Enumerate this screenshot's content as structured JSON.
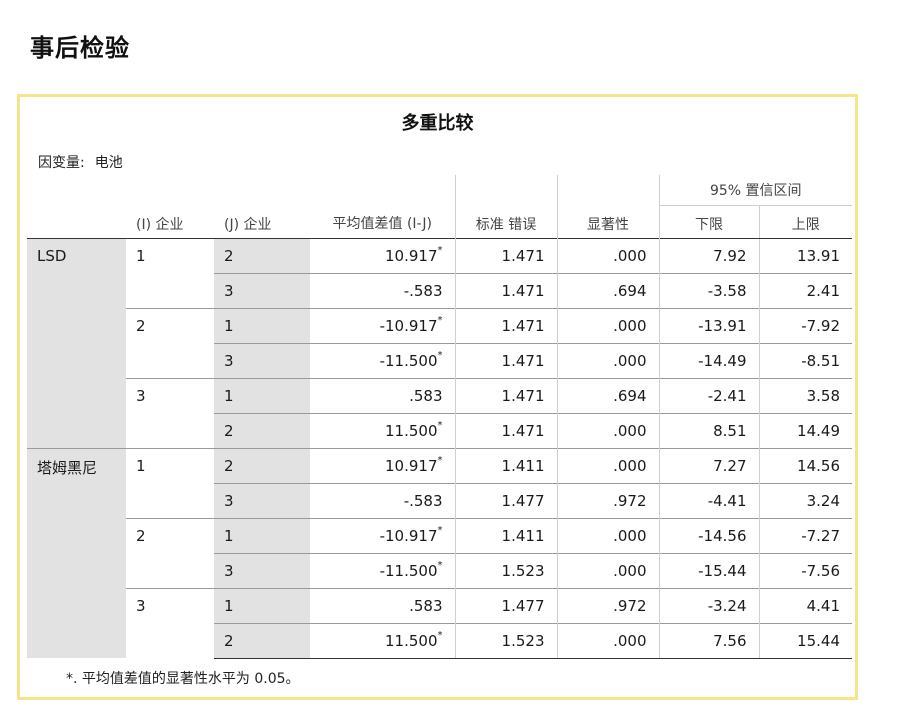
{
  "heading": "事后检验",
  "table": {
    "title": "多重比较",
    "dep_var_label": "因变量:",
    "dep_var_value": "电池",
    "headers": {
      "i": "(I) 企业",
      "j": "(J) 企业",
      "mean_diff": "平均值差值 (I-J)",
      "std_err": "标准 错误",
      "sig": "显著性",
      "ci_group": "95% 置信区间",
      "lower": "下限",
      "upper": "上限"
    },
    "groups": [
      {
        "method": "LSD",
        "blocks": [
          {
            "i": "1",
            "rows": [
              {
                "j": "2",
                "diff": "10.917",
                "star": "*",
                "se": "1.471",
                "sig": ".000",
                "lower": "7.92",
                "upper": "13.91"
              },
              {
                "j": "3",
                "diff": "-.583",
                "star": "",
                "se": "1.471",
                "sig": ".694",
                "lower": "-3.58",
                "upper": "2.41"
              }
            ]
          },
          {
            "i": "2",
            "rows": [
              {
                "j": "1",
                "diff": "-10.917",
                "star": "*",
                "se": "1.471",
                "sig": ".000",
                "lower": "-13.91",
                "upper": "-7.92"
              },
              {
                "j": "3",
                "diff": "-11.500",
                "star": "*",
                "se": "1.471",
                "sig": ".000",
                "lower": "-14.49",
                "upper": "-8.51"
              }
            ]
          },
          {
            "i": "3",
            "rows": [
              {
                "j": "1",
                "diff": ".583",
                "star": "",
                "se": "1.471",
                "sig": ".694",
                "lower": "-2.41",
                "upper": "3.58"
              },
              {
                "j": "2",
                "diff": "11.500",
                "star": "*",
                "se": "1.471",
                "sig": ".000",
                "lower": "8.51",
                "upper": "14.49"
              }
            ]
          }
        ]
      },
      {
        "method": "塔姆黑尼",
        "blocks": [
          {
            "i": "1",
            "rows": [
              {
                "j": "2",
                "diff": "10.917",
                "star": "*",
                "se": "1.411",
                "sig": ".000",
                "lower": "7.27",
                "upper": "14.56"
              },
              {
                "j": "3",
                "diff": "-.583",
                "star": "",
                "se": "1.477",
                "sig": ".972",
                "lower": "-4.41",
                "upper": "3.24"
              }
            ]
          },
          {
            "i": "2",
            "rows": [
              {
                "j": "1",
                "diff": "-10.917",
                "star": "*",
                "se": "1.411",
                "sig": ".000",
                "lower": "-14.56",
                "upper": "-7.27"
              },
              {
                "j": "3",
                "diff": "-11.500",
                "star": "*",
                "se": "1.523",
                "sig": ".000",
                "lower": "-15.44",
                "upper": "-7.56"
              }
            ]
          },
          {
            "i": "3",
            "rows": [
              {
                "j": "1",
                "diff": ".583",
                "star": "",
                "se": "1.477",
                "sig": ".972",
                "lower": "-3.24",
                "upper": "4.41"
              },
              {
                "j": "2",
                "diff": "11.500",
                "star": "*",
                "se": "1.523",
                "sig": ".000",
                "lower": "7.56",
                "upper": "15.44"
              }
            ]
          }
        ]
      }
    ],
    "footnote": "*. 平均值差值的显著性水平为 0.05。"
  }
}
